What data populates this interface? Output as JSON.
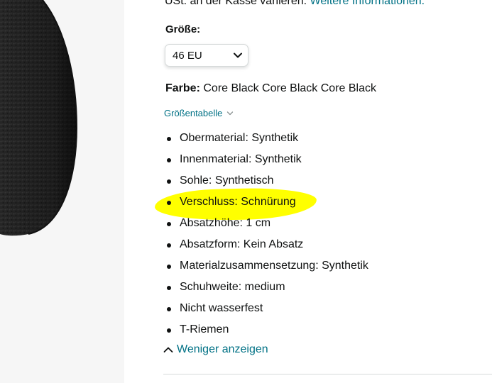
{
  "vat": {
    "text": "USt. an der Kasse variieren.",
    "link": "Weitere Informationen."
  },
  "size": {
    "label": "Größe:",
    "selected": "46 EU"
  },
  "color": {
    "label": "Farbe:",
    "value": "Core Black Core Black Core Black"
  },
  "size_chart": {
    "label": "Größentabelle"
  },
  "features": [
    "Obermaterial: Synthetik",
    "Innenmaterial: Synthetik",
    "Sohle: Synthetisch",
    "Verschluss: Schnürung",
    "Absatzhöhe: 1 cm",
    "Absatzform: Kein Absatz",
    "Materialzusammensetzung: Synthetik",
    "Schuhweite: medium",
    "Nicht wasserfest",
    "T-Riemen"
  ],
  "show_less": {
    "label": "Weniger anzeigen"
  },
  "colors": {
    "link": "#007185",
    "text": "#0f1111",
    "highlight": "#ffff00"
  },
  "icons": {
    "size_dropdown": "chevron-down-icon",
    "size_chart": "chevron-down-icon",
    "show_less": "chevron-up-icon"
  }
}
